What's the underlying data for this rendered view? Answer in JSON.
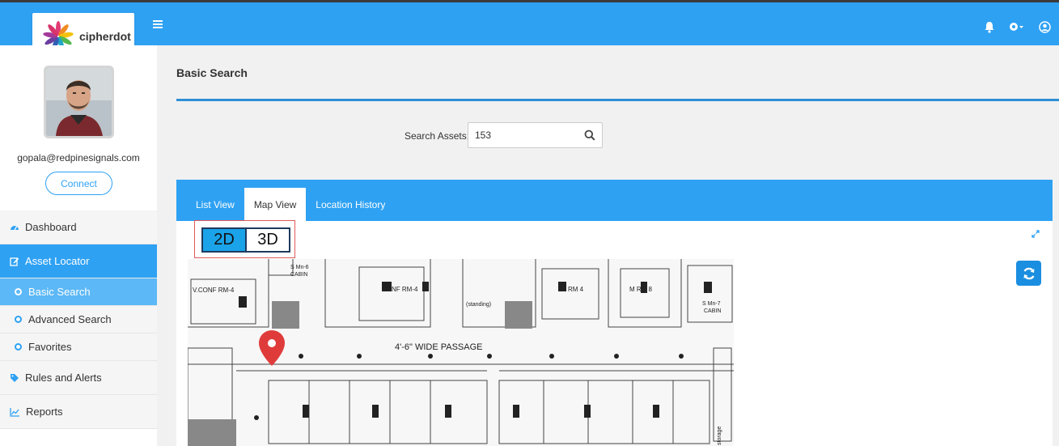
{
  "brand": {
    "name": "cipherdot"
  },
  "topbar": {
    "icons": [
      "menu-icon",
      "bell-icon",
      "gear-icon",
      "user-icon"
    ]
  },
  "user": {
    "email": "gopala@redpinesignals.com",
    "connect_label": "Connect"
  },
  "sidebar": {
    "items": [
      {
        "label": "Dashboard",
        "icon": "dashboard-icon"
      },
      {
        "label": "Asset Locator",
        "icon": "edit-icon",
        "active": true
      },
      {
        "label": "Basic Search",
        "sub": true,
        "active": true
      },
      {
        "label": "Advanced Search",
        "sub": true
      },
      {
        "label": "Favorites",
        "sub": true
      },
      {
        "label": "Rules and Alerts",
        "icon": "tags-icon"
      },
      {
        "label": "Reports",
        "icon": "chart-icon"
      }
    ]
  },
  "page": {
    "title": "Basic Search"
  },
  "search": {
    "label": "Search Assets:",
    "value": "153"
  },
  "tabs": [
    {
      "label": "List View"
    },
    {
      "label": "Map View",
      "active": true
    },
    {
      "label": "Location History"
    }
  ],
  "view_toggle": {
    "option_2d": "2D",
    "option_3d": "3D",
    "selected": "2D"
  },
  "map": {
    "labels": {
      "v_conf": "V.CONF RM-4",
      "conf": "CONF RM-4",
      "wide_passage": "4'-6\" WIDE PASSAGE",
      "s_mn6": "S Mn-6",
      "cabin1": "CABIN",
      "rm4": "RM 4",
      "standing": "(standing)",
      "m_rm8": "M RM 8",
      "s_mn7": "S Mn-7",
      "cabin2": "CABIN",
      "storage": "storage"
    }
  },
  "colors": {
    "primary": "#2ea1f3",
    "marker": "#e03b3b",
    "toggle_active": "#1aa3e8"
  }
}
